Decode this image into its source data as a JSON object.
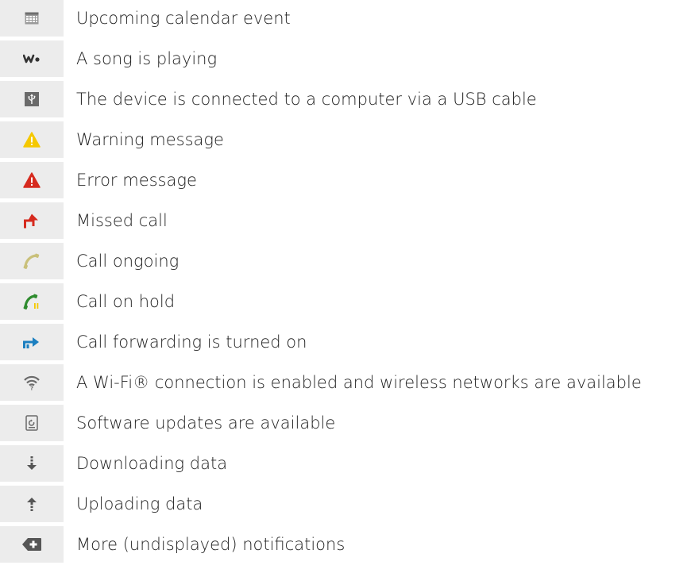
{
  "notifications": [
    {
      "icon": "calendar-icon",
      "label": "Upcoming calendar event"
    },
    {
      "icon": "walkman-icon",
      "label": "A song is playing"
    },
    {
      "icon": "usb-icon",
      "label": "The device is connected to a computer via a USB cable"
    },
    {
      "icon": "warning-icon",
      "label": "Warning message",
      "color": "#f5c800"
    },
    {
      "icon": "error-icon",
      "label": "Error message",
      "color": "#d62a1e"
    },
    {
      "icon": "missed-call-icon",
      "label": "Missed call",
      "color": "#d62a1e"
    },
    {
      "icon": "call-ongoing-icon",
      "label": "Call ongoing",
      "color": "#c9c07a"
    },
    {
      "icon": "call-on-hold-icon",
      "label": "Call on hold",
      "color": "#2e8b2e"
    },
    {
      "icon": "call-forwarding-icon",
      "label": "Call forwarding is turned on",
      "color": "#1c7fc0"
    },
    {
      "icon": "wifi-icon",
      "label": "A Wi-Fi® connection is enabled and wireless networks are available"
    },
    {
      "icon": "software-update-icon",
      "label": "Software updates are available"
    },
    {
      "icon": "download-icon",
      "label": "Downloading data"
    },
    {
      "icon": "upload-icon",
      "label": "Uploading data"
    },
    {
      "icon": "more-notifications-icon",
      "label": "More (undisplayed) notifications"
    }
  ]
}
